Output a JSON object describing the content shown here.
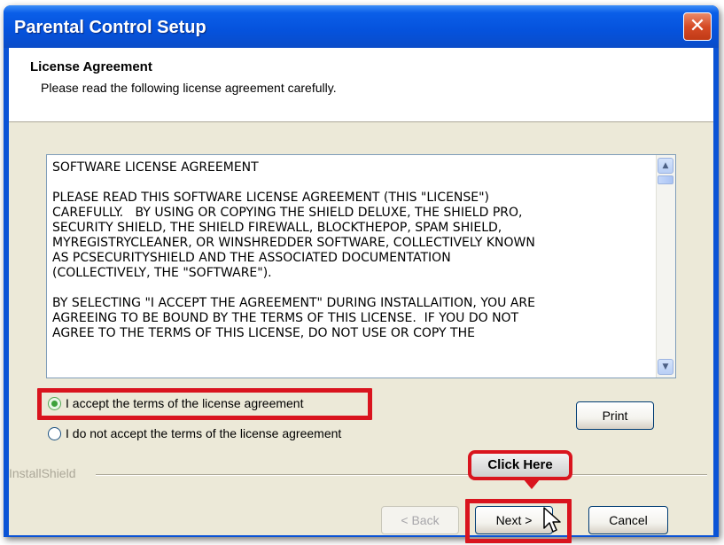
{
  "window": {
    "title": "Parental Control Setup",
    "close_glyph": "✕"
  },
  "header": {
    "title": "License Agreement",
    "subtitle": "Please read the following license agreement carefully."
  },
  "license": {
    "text": "SOFTWARE LICENSE AGREEMENT\n\nPLEASE READ THIS SOFTWARE LICENSE AGREEMENT (THIS \"LICENSE\")\nCAREFULLY.   BY USING OR COPYING THE SHIELD DELUXE, THE SHIELD PRO,\nSECURITY SHIELD, THE SHIELD FIREWALL, BLOCKTHEPOP, SPAM SHIELD,\nMYREGISTRYCLEANER, OR WINSHREDDER SOFTWARE, COLLECTIVELY KNOWN\nAS PCSECURITYSHIELD AND THE ASSOCIATED DOCUMENTATION\n(COLLECTIVELY, THE \"SOFTWARE\").\n\nBY SELECTING \"I ACCEPT THE AGREEMENT\" DURING INSTALLAITION, YOU ARE\nAGREEING TO BE BOUND BY THE TERMS OF THIS LICENSE.  IF YOU DO NOT\nAGREE TO THE TERMS OF THIS LICENSE, DO NOT USE OR COPY THE"
  },
  "options": {
    "accept_label": "I accept the terms of the license agreement",
    "decline_label": "I do not accept the terms of the license agreement",
    "selected": "accept"
  },
  "buttons": {
    "print": "Print",
    "back": "< Back",
    "next": "Next >",
    "cancel": "Cancel"
  },
  "footer": {
    "brand": "InstallShield"
  },
  "annotation": {
    "callout": "Click Here"
  },
  "colors": {
    "title_bar": "#0552dc",
    "highlight": "#d9141e",
    "dialog_bg": "#ece9d8"
  }
}
